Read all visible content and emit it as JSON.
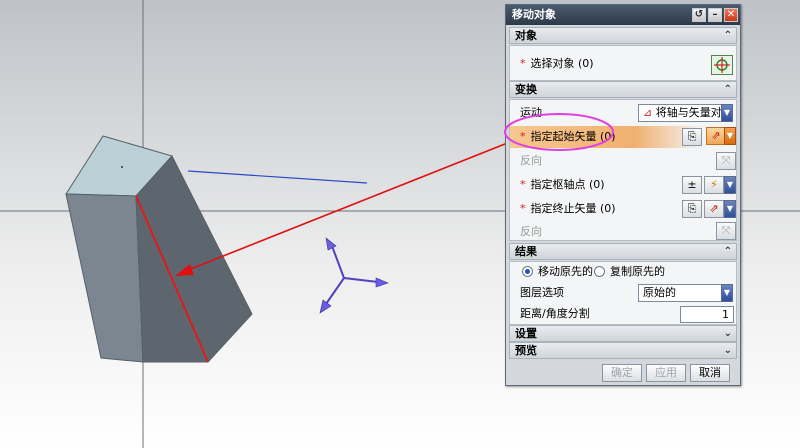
{
  "dialog": {
    "title": "移动对象",
    "titlebar_buttons": {
      "reset": "↺",
      "minimize": "–",
      "close": "✕"
    }
  },
  "object_section": {
    "header": "对象",
    "select_object": {
      "required": "*",
      "label": "选择对象 (0)"
    }
  },
  "transform_section": {
    "header": "变换",
    "motion_label": "运动",
    "motion_value": "将轴与矢量对齐",
    "specify_start_vector": {
      "required": "*",
      "label": "指定起始矢量 (0)"
    },
    "reverse_1": "反向",
    "specify_pivot_point": {
      "required": "*",
      "label": "指定枢轴点 (0)"
    },
    "specify_end_vector": {
      "required": "*",
      "label": "指定终止矢量 (0)"
    },
    "reverse_2": "反向"
  },
  "result_section": {
    "header": "结果",
    "radio_move": "移动原先的",
    "radio_copy": "复制原先的",
    "layer_option_label": "图层选项",
    "layer_option_value": "原始的",
    "distance_angle_label": "距离/角度分割",
    "distance_angle_value": "1"
  },
  "settings_section": {
    "header": "设置"
  },
  "preview_section": {
    "header": "预览"
  },
  "footer": {
    "ok": "确定",
    "apply": "应用",
    "cancel": "取消"
  },
  "colors": {
    "highlight_ellipse": "#e040e0",
    "arrow": "#e01010",
    "selected_row_gradient": "#f0b070",
    "titlebar": "#3a4658",
    "triad_axis": "#5a4ec8"
  }
}
